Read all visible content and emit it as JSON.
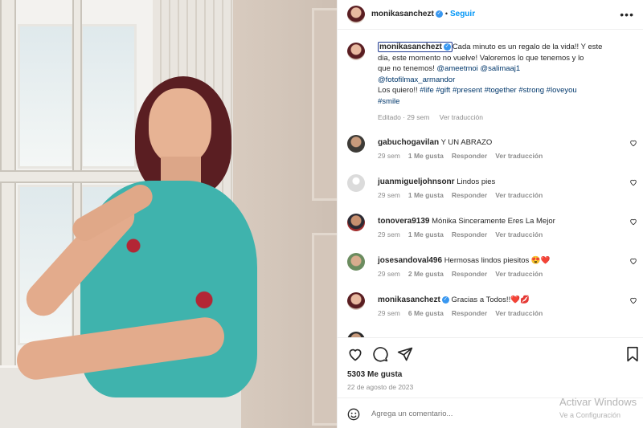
{
  "post": {
    "author": "monikasanchezt",
    "separator": "•",
    "follow_label": "Seguir",
    "more_icon": "more-horizontal-icon",
    "caption": {
      "line1": "Cada minuto es un regalo de la vida!! Y este",
      "line2": "dia, este momento no vuelve! Valoremos lo que tenemos y lo",
      "line3a": "que no tenemos! ",
      "mention1": "@ameetmoi",
      "mention2": "@salimaaj1",
      "mention3": "@fotofilmax_armandor",
      "line5a": "Los quiero!! ",
      "tags1": "#life #gift #present #together #strong #loveyou",
      "tags2": "#smile",
      "edited": "Editado",
      "time": "29 sem",
      "translate": "Ver traducción"
    }
  },
  "comments": [
    {
      "user": "gabuchogavilan",
      "text": "Y UN ABRAZO",
      "time": "29 sem",
      "likes": "1 Me gusta",
      "reply": "Responder",
      "translate": "Ver traducción"
    },
    {
      "user": "juanmigueljohnsonr",
      "text": "Lindos pies",
      "time": "29 sem",
      "likes": "1 Me gusta",
      "reply": "Responder",
      "translate": "Ver traducción"
    },
    {
      "user": "tonovera9139",
      "text": "Mónika Sinceramente Eres La Mejor",
      "time": "29 sem",
      "likes": "1 Me gusta",
      "reply": "Responder",
      "translate": "Ver traducción"
    },
    {
      "user": "josesandoval496",
      "text": "Hermosas lindos piesitos 😍❤️",
      "time": "29 sem",
      "likes": "2 Me gusta",
      "reply": "Responder",
      "translate": "Ver traducción"
    },
    {
      "user": "monikasanchezt",
      "text": "Gracias a Todos!!❤️💋",
      "time": "29 sem",
      "likes": "6 Me gusta",
      "reply": "Responder",
      "translate": "Ver traducción"
    }
  ],
  "actions": {
    "like_icon": "heart-icon",
    "comment_icon": "comment-icon",
    "share_icon": "send-icon",
    "save_icon": "bookmark-icon",
    "likes_count": "5303 Me gusta",
    "date": "22 de agosto de 2023"
  },
  "comment_bar": {
    "emoji_icon": "emoji-icon",
    "placeholder": "Agrega un comentario..."
  },
  "watermark": {
    "title": "Activar Windows",
    "subtitle": "Ve a Configuración"
  },
  "colors": {
    "accent": "#0095f6",
    "verified": "#3897f0",
    "heart_red": "#ed4956",
    "muted": "#8e8e8e"
  }
}
